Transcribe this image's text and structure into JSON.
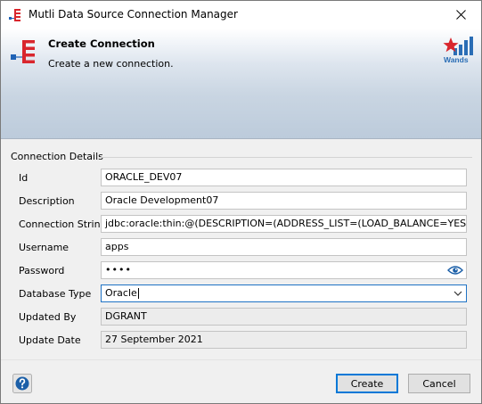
{
  "window": {
    "title": "Mutli Data Source Connection Manager"
  },
  "banner": {
    "title": "Create Connection",
    "subtitle": "Create a new connection.",
    "logo_text": "Wands"
  },
  "section": {
    "label": "Connection Details"
  },
  "fields": {
    "id": {
      "label": "Id",
      "value": "ORACLE_DEV07"
    },
    "description": {
      "label": "Description",
      "value": "Oracle Development07"
    },
    "connection_string": {
      "label": "Connection String",
      "value": "jdbc:oracle:thin:@(DESCRIPTION=(ADDRESS_LIST=(LOAD_BALANCE=YES)(FAILOVER=YES)"
    },
    "username": {
      "label": "Username",
      "value": "apps"
    },
    "password": {
      "label": "Password",
      "value": "••••"
    },
    "database_type": {
      "label": "Database Type",
      "value": "Oracle"
    },
    "updated_by": {
      "label": "Updated By",
      "value": "DGRANT"
    },
    "update_date": {
      "label": "Update Date",
      "value": "27 September 2021"
    }
  },
  "buttons": {
    "create": "Create",
    "cancel": "Cancel"
  },
  "icons": {
    "app": "network-tree-icon",
    "banner": "network-tree-icon",
    "close": "close-icon",
    "help": "help-icon",
    "eye": "eye-icon",
    "dropdown": "chevron-down-icon",
    "logo": "wands-logo-icon"
  },
  "colors": {
    "accent": "#0078d7",
    "help": "#1b5fa8",
    "brand_red": "#d9262d",
    "brand_blue": "#2a6db5",
    "banner_blue": "#1f62b5"
  }
}
